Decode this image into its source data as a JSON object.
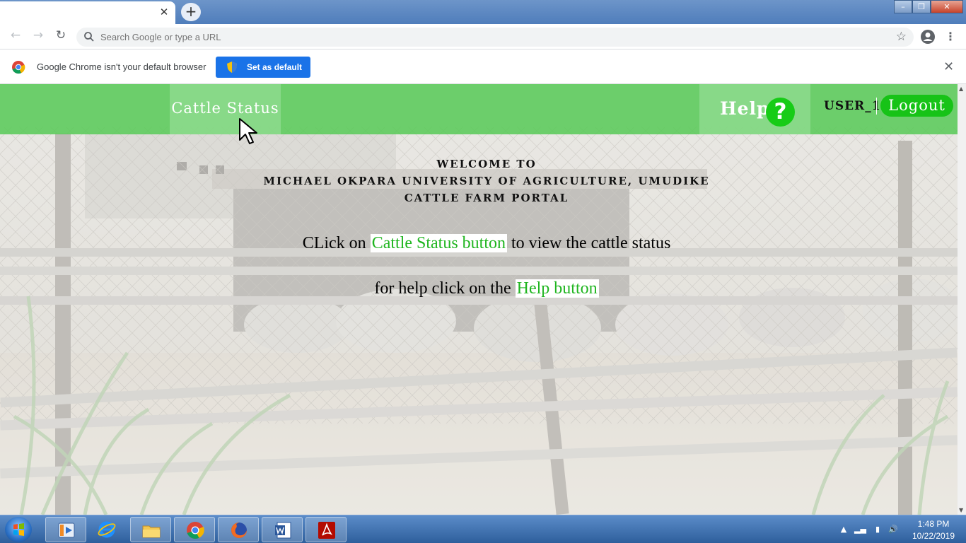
{
  "browser": {
    "tab_title": "",
    "omnibox_placeholder": "Search Google or type a URL",
    "infobar_text": "Google Chrome isn't your default browser",
    "set_default_label": "Set as default"
  },
  "page": {
    "nav": {
      "cattle_status": "Cattle Status",
      "help": "Help",
      "help_icon_glyph": "?",
      "user": "USER_1",
      "logout": "Logout"
    },
    "welcome_lines": [
      "WELCOME TO",
      "MICHAEL OKPARA UNIVERSITY OF AGRICULTURE, UMUDIKE",
      "CATTLE FARM PORTAL"
    ],
    "instruction_1": {
      "before": "CLick on ",
      "highlight": "Cattle Status button",
      "after": " to view the cattle status"
    },
    "instruction_2": {
      "before": "for help click on the ",
      "highlight": "Help button"
    },
    "colors": {
      "nav_green": "#50c850",
      "accent_green": "#1fb51f",
      "logout_green": "#17c317"
    }
  },
  "taskbar": {
    "apps": [
      "media-player-icon",
      "internet-explorer-icon",
      "file-explorer-icon",
      "chrome-icon",
      "firefox-icon",
      "word-icon",
      "acrobat-icon"
    ],
    "clock_time": "1:48 PM",
    "clock_date": "10/22/2019"
  }
}
